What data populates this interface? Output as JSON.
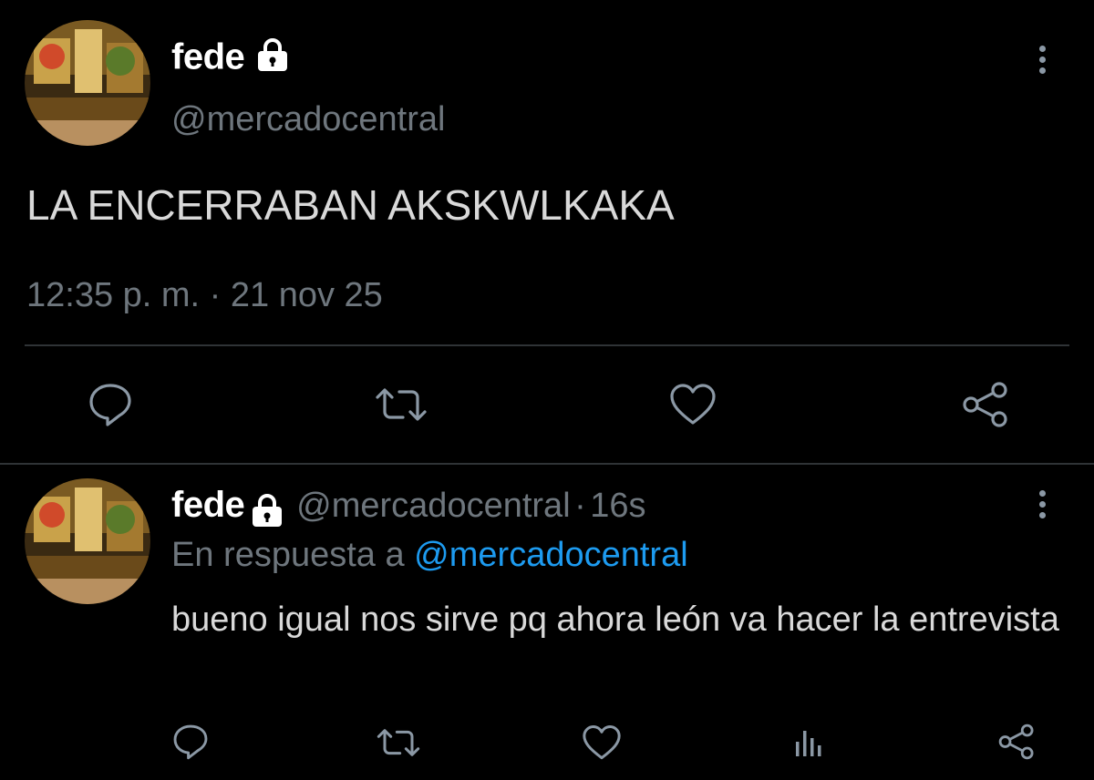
{
  "main_tweet": {
    "display_name": "fede",
    "handle": "@mercadocentral",
    "text": "LA ENCERRABAN AKSKWLKAKA",
    "timestamp": "12:35 p. m. · 21 nov 25",
    "actions": [
      "reply-icon",
      "retweet-icon",
      "like-icon",
      "share-icon"
    ]
  },
  "reply_tweet": {
    "display_name": "fede",
    "handle": "@mercadocentral",
    "separator": "·",
    "age": "16s",
    "in_reply_prefix": "En respuesta a",
    "in_reply_handle": "@mercadocentral",
    "text": "bueno igual nos sirve pq ahora león va hacer la entrevista",
    "actions": [
      "reply-icon",
      "retweet-icon",
      "like-icon",
      "analytics-icon",
      "share-icon"
    ]
  },
  "colors": {
    "background": "#000000",
    "text": "#d9d9d9",
    "muted": "#6e767d",
    "link": "#1d9bf0",
    "divider": "#2f3336"
  }
}
